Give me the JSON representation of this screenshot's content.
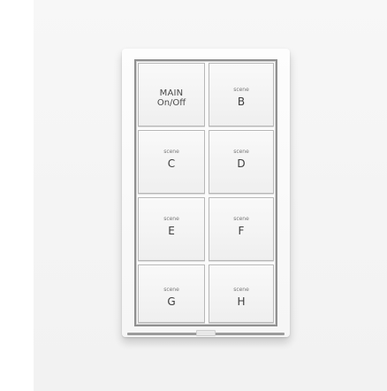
{
  "keypad": {
    "keys": [
      {
        "top": "MAIN",
        "bottom": "On/Off"
      },
      {
        "top": "scene",
        "bottom": "B"
      },
      {
        "top": "scene",
        "bottom": "C"
      },
      {
        "top": "scene",
        "bottom": "D"
      },
      {
        "top": "scene",
        "bottom": "E"
      },
      {
        "top": "scene",
        "bottom": "F"
      },
      {
        "top": "scene",
        "bottom": "G"
      },
      {
        "top": "scene",
        "bottom": "H"
      }
    ]
  },
  "colors": {
    "device_body": "#f7f7f7",
    "key_face": "#f1f1f1",
    "keypad_border": "#8f8f8f",
    "text": "#4a4a4a"
  }
}
